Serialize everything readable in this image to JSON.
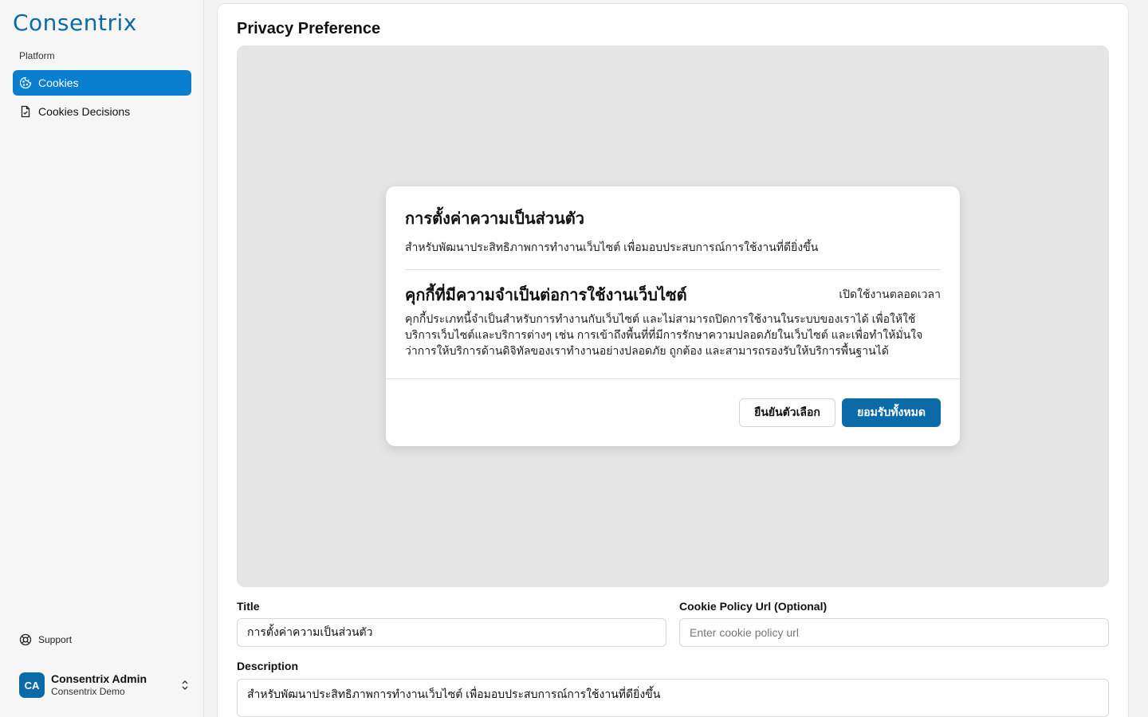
{
  "sidebar": {
    "logo": "Consentrix",
    "section_label": "Platform",
    "items": [
      {
        "label": "Cookies",
        "icon": "cookie-icon",
        "active": true
      },
      {
        "label": "Cookies Decisions",
        "icon": "file-check-icon",
        "active": false
      }
    ],
    "support_label": "Support",
    "user": {
      "initials": "CA",
      "name": "Consentrix Admin",
      "org": "Consentrix Demo"
    }
  },
  "main": {
    "page_title": "Privacy Preference",
    "modal": {
      "title": "การตั้งค่าความเป็นส่วนตัว",
      "description": "สำหรับพัฒนาประสิทธิภาพการทำงานเว็บไซต์ เพื่อมอบประสบการณ์การใช้งานที่ดียิ่งขึ้น",
      "category_title": "คุกกี้ที่มีความจำเป็นต่อการใช้งานเว็บไซต์",
      "category_status": "เปิดใช้งานตลอดเวลา",
      "category_desc": "คุกกี้ประเภทนี้จำเป็นสำหรับการทำงานกับเว็บไซต์ และไม่สามารถปิดการใช้งานในระบบของเราได้ เพื่อให้ใช้บริการเว็บไซต์และบริการต่างๆ เช่น การเข้าถึงพื้นที่ที่มีการรักษาความปลอดภัยในเว็บไซต์ และเพื่อทำให้มั่นใจว่าการให้บริการด้านดิจิทัลของเราทำงานอย่างปลอดภัย ถูกต้อง และสามารถรองรับให้บริการพื้นฐานได้",
      "confirm_label": "ยืนยันตัวเลือก",
      "accept_all_label": "ยอมรับทั้งหมด"
    },
    "form": {
      "title_label": "Title",
      "title_value": "การตั้งค่าความเป็นส่วนตัว",
      "policy_url_label": "Cookie Policy Url (Optional)",
      "policy_url_placeholder": "Enter cookie policy url",
      "description_label": "Description",
      "description_value": "สำหรับพัฒนาประสิทธิภาพการทำงานเว็บไซต์ เพื่อมอบประสบการณ์การใช้งานที่ดียิ่งขึ้น"
    }
  },
  "colors": {
    "brand": "#0a6ba8",
    "active_nav": "#0a7fd0",
    "preview_bg": "#e5e5e5"
  }
}
